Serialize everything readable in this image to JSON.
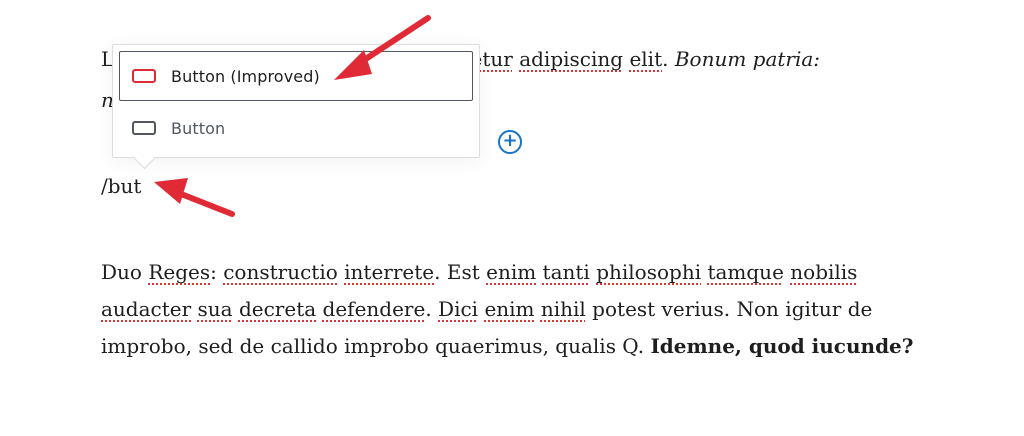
{
  "paragraph1": {
    "line1_start": "L",
    "line1_squig1": "ctetur",
    "line1_space1": " ",
    "line1_squig2": "adipiscing",
    "line1_space2": " ",
    "line1_squig3": "elit",
    "line1_period": ". ",
    "line1_italic": "Bonum patria:",
    "line2_italic": "n"
  },
  "slash_command": "/but",
  "inserter": {
    "options": [
      {
        "label": "Button (Improved)",
        "icon": "button-block-icon",
        "selected": true,
        "icon_color": "#e02a36"
      },
      {
        "label": "Button",
        "icon": "button-block-icon",
        "selected": false,
        "icon_color": "#50575e"
      }
    ]
  },
  "paragraph2": {
    "w1": "Duo",
    "w2": "Reges",
    "t1": ": ",
    "w3": "constructio",
    "t2": " ",
    "w4": "interrete",
    "t3": ". Est ",
    "w5": "enim",
    "t4": " ",
    "w6": "tanti",
    "t5": " ",
    "w7": "philosophi",
    "t6": " ",
    "w8": "tamque",
    "t7": " ",
    "w9": "nobilis",
    "t8": " ",
    "w10": "audacter",
    "t9": " ",
    "w11": "sua",
    "t10": " ",
    "w12": "decreta",
    "t11": " ",
    "w13": "defendere",
    "t12": ". ",
    "w14": "Dici",
    "t13": " ",
    "w15": "enim",
    "t14": " ",
    "w16": "nihil",
    "t15": " potest verius. Non igitur de improbo, sed de callido improbo quaerimus, qualis Q. ",
    "bold": "Idemne, quod iucunde?"
  },
  "colors": {
    "annotation_arrow": "#e02a36",
    "inserter_plus": "#1476c8",
    "spellcheck_underline": "#d63638"
  }
}
